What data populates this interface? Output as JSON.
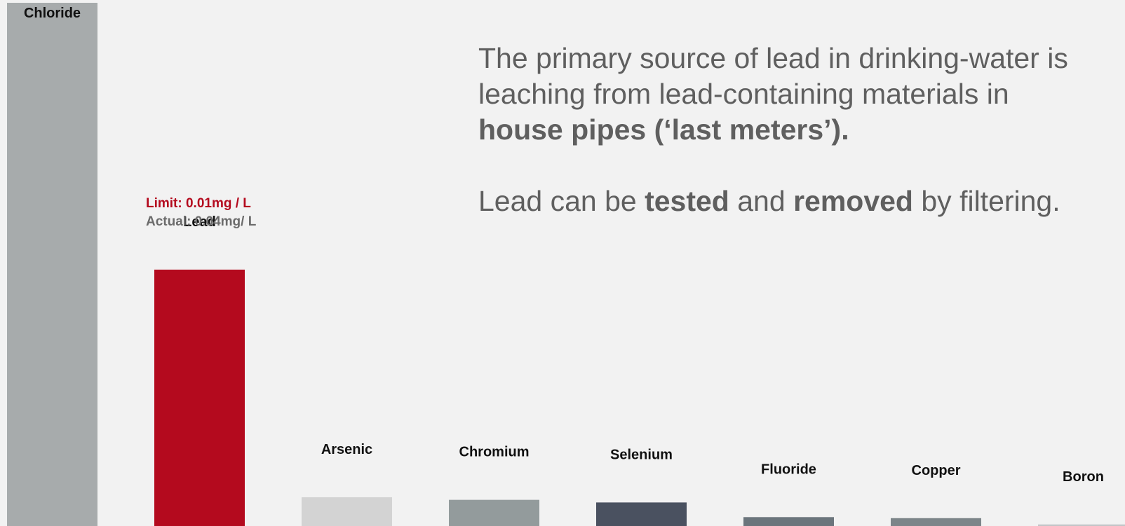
{
  "chart_data": {
    "type": "bar",
    "categories": [
      "Chloride",
      "Lead",
      "Arsenic",
      "Chromium",
      "Selenium",
      "Fluoride",
      "Copper",
      "Boron"
    ],
    "values": [
      100,
      49,
      5.5,
      5,
      4.5,
      1.7,
      1.5,
      0.3
    ],
    "colors": [
      "#a7abac",
      "#b40a1e",
      "#d3d3d3",
      "#939b9c",
      "#4a5160",
      "#6b757c",
      "#7c8589",
      "#c3c6c8"
    ],
    "ylim": [
      0,
      100
    ],
    "title": "",
    "xlabel": "",
    "ylabel": "",
    "annotations": {
      "limit": "Limit: 0.01mg / L",
      "actual": "Actual: 0.04mg/ L"
    }
  },
  "message": {
    "line1": "The primary source of lead in drinking-water is leaching from lead-containing materials in",
    "line1_bold": "house pipes (‘last meters’).",
    "line2_a": "Lead can be ",
    "line2_b": "tested",
    "line2_c": " and ",
    "line2_d": "removed",
    "line2_e": " by filtering."
  }
}
